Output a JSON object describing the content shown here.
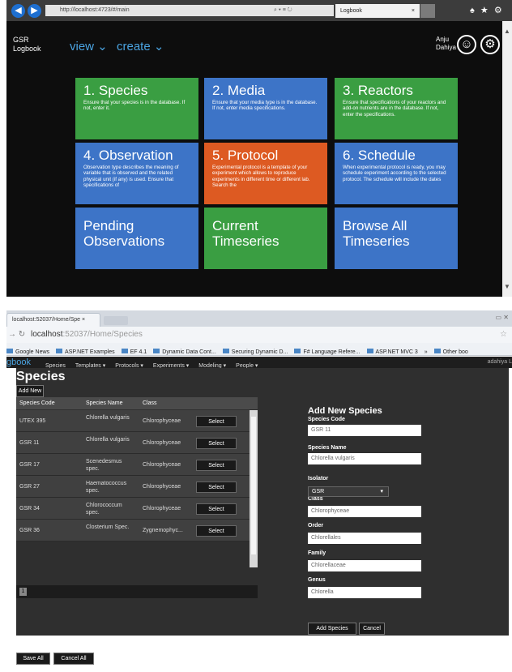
{
  "screen1": {
    "browser": {
      "address": "http://localhost:4723/#/main",
      "tab_title": "Logbook",
      "tab_close": "×",
      "toolbar_icons": "♠ ★ ⚙"
    },
    "brand": {
      "line1": "GSR",
      "line2": "Logbook"
    },
    "nav": {
      "view": "view ⌄",
      "create": "create ⌄"
    },
    "user": {
      "first": "Anju",
      "last": "Dahiya"
    },
    "tiles": [
      {
        "title": "1. Species",
        "desc": "Ensure that your species is in the database. If not, enter it.",
        "color": "green"
      },
      {
        "title": "2. Media",
        "desc": "Ensure that your media type is in the database. If not, enter media specifications.",
        "color": "blue"
      },
      {
        "title": "3. Reactors",
        "desc": "Ensure that specifications of your reactors and add-on nutrients are in the database. If not, enter the specifications.",
        "color": "green"
      },
      {
        "title": "4. Observation",
        "desc": "Observation type describes the meaning of variable that is observed and the related physical unit (if any) is used. Ensure that specifications of",
        "color": "blue"
      },
      {
        "title": "5. Protocol",
        "desc": "Experimental protocol is a template of your experiment which allows to reproduce experiments in different time or different lab. Search the",
        "color": "orange"
      },
      {
        "title": "6. Schedule",
        "desc": "When experimental protocol is ready, you may schedule experiment according to the selected protocol. The schedule will include the dates",
        "color": "blue"
      },
      {
        "title": "Pending Observations",
        "desc": "",
        "color": "blue"
      },
      {
        "title": "Current Timeseries",
        "desc": "",
        "color": "green"
      },
      {
        "title": "Browse All Timeseries",
        "desc": "",
        "color": "blue"
      }
    ],
    "colors": {
      "green": "#3a9e42",
      "blue": "#3d74c7",
      "orange": "#dd5a22",
      "background": "#0d0d0d",
      "link": "#4aa3e0"
    }
  },
  "screen2": {
    "browser": {
      "tab_title": "localhost:52037/Home/Spe ×",
      "url_host": "localhost",
      "url_rest": ":52037/Home/Species",
      "bookmarks": [
        "Google News",
        "ASP.NET Examples",
        "EF 4.1",
        "Dynamic Data Cont...",
        "Securing Dynamic D...",
        "F# Language Refere...",
        "ASP.NET MVC 3",
        "»",
        "Other boo"
      ]
    },
    "appnav": {
      "logo": "gbook",
      "items": [
        "Species",
        "Templates ▾",
        "Protocols ▾",
        "Experiments ▾",
        "Modeling ▾",
        "People ▾"
      ],
      "user": "adahiya L"
    },
    "page_title": "Species",
    "add_new": "Add New",
    "table": {
      "headers": [
        "Species Code",
        "Species Name",
        "Class"
      ],
      "select_label": "Select",
      "rows": [
        {
          "code": "UTEX 395",
          "name": "Chlorella vulgaris",
          "class": "Chlorophyceae"
        },
        {
          "code": "GSR 11",
          "name": "Chlorella vulgaris",
          "class": "Chlorophyceae"
        },
        {
          "code": "GSR 17",
          "name": "Scenedesmus spec.",
          "class": "Chlorophyceae"
        },
        {
          "code": "GSR 27",
          "name": "Haematococcus spec.",
          "class": "Chlorophyceae"
        },
        {
          "code": "GSR 34",
          "name": "Chlorococcum spec.",
          "class": "Chlorophyceae"
        },
        {
          "code": "GSR 36",
          "name": "Closterium Spec.",
          "class": "Zygnemophyc..."
        }
      ],
      "page": "1"
    },
    "form": {
      "title": "Add New Species",
      "fields": {
        "species_code": {
          "label": "Species Code",
          "value": "GSR 11"
        },
        "species_name": {
          "label": "Species Name",
          "value": "Chlorella vulgaris"
        },
        "isolator": {
          "label": "Isolator",
          "value": "GSR"
        },
        "class": {
          "label": "Class",
          "value": "Chlorophyceae"
        },
        "order": {
          "label": "Order",
          "value": "Chlorellales"
        },
        "family": {
          "label": "Family",
          "value": "Chlorellaceae"
        },
        "genus": {
          "label": "Genus",
          "value": "Chlorella"
        }
      },
      "add_button": "Add Species",
      "cancel_button": "Cancel"
    },
    "save_all": "Save All",
    "cancel_all": "Cancel All"
  }
}
